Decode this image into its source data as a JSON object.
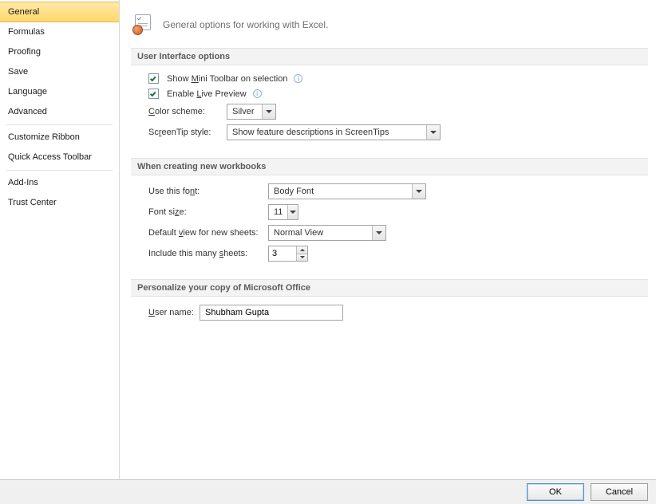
{
  "sidebar": {
    "items": [
      {
        "label": "General",
        "selected": true
      },
      {
        "label": "Formulas"
      },
      {
        "label": "Proofing"
      },
      {
        "label": "Save"
      },
      {
        "label": "Language"
      },
      {
        "label": "Advanced"
      },
      {
        "label": "Customize Ribbon"
      },
      {
        "label": "Quick Access Toolbar"
      },
      {
        "label": "Add-Ins"
      },
      {
        "label": "Trust Center"
      }
    ]
  },
  "header": {
    "text": "General options for working with Excel."
  },
  "sections": {
    "ui": {
      "title": "User Interface options",
      "miniToolbarPrefix": "Show ",
      "miniToolbarU": "M",
      "miniToolbarSuffix": "ini Toolbar on selection",
      "livePreviewPrefix": "Enable ",
      "livePreviewU": "L",
      "livePreviewSuffix": "ive Preview",
      "colorSchemePrefix": "",
      "colorSchemeU": "C",
      "colorSchemeSuffix": "olor scheme:",
      "colorSchemeValue": "Silver",
      "screenTipPrefix": "Sc",
      "screenTipU": "r",
      "screenTipSuffix": "eenTip style:",
      "screenTipValue": "Show feature descriptions in ScreenTips"
    },
    "newwb": {
      "title": "When creating new workbooks",
      "useFontPrefix": "Use this fo",
      "useFontU": "n",
      "useFontSuffix": "t:",
      "useFontValue": "Body Font",
      "fontSizePrefix": "Font si",
      "fontSizeU": "z",
      "fontSizeSuffix": "e:",
      "fontSizeValue": "11",
      "defaultViewPrefix": "Default ",
      "defaultViewU": "v",
      "defaultViewSuffix": "iew for new sheets:",
      "defaultViewValue": "Normal View",
      "sheetsPrefix": "Include this many ",
      "sheetsU": "s",
      "sheetsSuffix": "heets:",
      "sheetsValue": "3"
    },
    "personalize": {
      "title": "Personalize your copy of Microsoft Office",
      "userNameU": "U",
      "userNameSuffix": "ser name:",
      "userNameValue": "Shubham Gupta"
    }
  },
  "footer": {
    "ok": "OK",
    "cancel": "Cancel"
  }
}
